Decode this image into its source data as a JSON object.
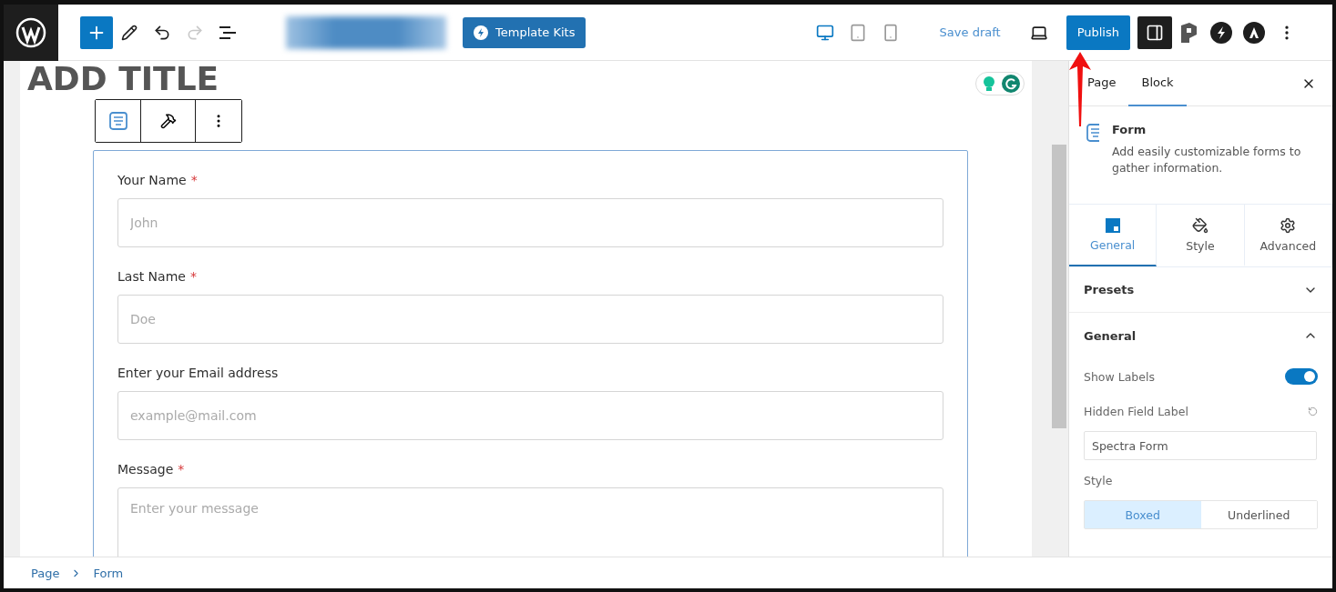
{
  "topbar": {
    "redo_disabled": true,
    "template_kits": "Template Kits",
    "devices": [
      {
        "kind": "desktop",
        "selected": true
      },
      {
        "kind": "tablet",
        "selected": false
      },
      {
        "kind": "mobile",
        "selected": false
      }
    ],
    "save_draft": "Save draft",
    "publish": "Publish",
    "settings_open": true
  },
  "canvas": {
    "title": "ADD TITLE",
    "form": {
      "fields": [
        {
          "kind": "text",
          "label": "Your Name",
          "required_mark": "*",
          "placeholder": "John"
        },
        {
          "kind": "text",
          "label": "Last Name",
          "required_mark": "*",
          "placeholder": "Doe"
        },
        {
          "kind": "text",
          "label": "Enter your Email address",
          "placeholder": "example@mail.com"
        },
        {
          "kind": "textarea",
          "label": "Message",
          "required_mark": "*",
          "placeholder": "Enter your message"
        }
      ]
    }
  },
  "sidebar": {
    "tabs": [
      {
        "label": "Page",
        "selected": false
      },
      {
        "label": "Block",
        "selected": true
      }
    ],
    "block": {
      "name": "Form",
      "description": "Add easily customizable forms to gather information."
    },
    "section_tabs": [
      {
        "kind": "general",
        "label": "General",
        "selected": true
      },
      {
        "kind": "style",
        "label": "Style",
        "selected": false
      },
      {
        "kind": "advanced",
        "label": "Advanced",
        "selected": false
      }
    ],
    "panels": [
      {
        "title": "Presets",
        "expanded": false
      },
      {
        "title": "General",
        "expanded": true
      }
    ],
    "show_labels": {
      "label": "Show Labels",
      "on": true
    },
    "hidden_field_label": {
      "label": "Hidden Field Label",
      "value": "Spectra Form"
    },
    "style": {
      "label": "Style",
      "options": [
        {
          "label": "Boxed",
          "selected": true
        },
        {
          "label": "Underlined",
          "selected": false
        }
      ]
    }
  },
  "breadcrumb": [
    "Page",
    "Form"
  ]
}
